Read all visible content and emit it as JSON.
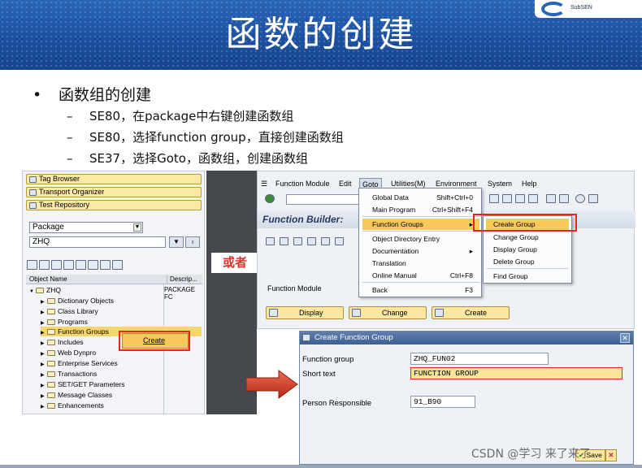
{
  "slide": {
    "title": "函数的创建",
    "bullet_main": "函数组的创建",
    "bullets_sub": [
      "SE80，在package中右键创建函数组",
      "SE80，选择function group，直接创建函数组",
      "SE37，选择Goto，函数组，创建函数组"
    ],
    "or_label": "或者",
    "watermark": "CSDN @学习  来了来了",
    "logo_text": "SubSEN",
    "bullet_dot": "•",
    "dash": "–"
  },
  "left_panel": {
    "yellow_buttons": [
      "Tag Browser",
      "Transport Organizer",
      "Test Repository"
    ],
    "object_type": "Package",
    "object_name": "ZHQ",
    "tree_header": {
      "col1": "Object Name",
      "col2": "Descrip..."
    },
    "root": {
      "label": "ZHQ",
      "description": "PACKAGE FC"
    },
    "tree_items": [
      "Dictionary Objects",
      "Class Library",
      "Programs",
      "Function Groups",
      "Includes",
      "Web Dynpro",
      "Enterprise Services",
      "Transactions",
      "SET/GET Parameters",
      "Message Classes",
      "Enhancements"
    ],
    "context_menu": "Create"
  },
  "sap_window": {
    "menu": [
      "Function Module",
      "Edit",
      "Goto",
      "Utilities(M)",
      "Environment",
      "System",
      "Help"
    ],
    "title": "Function Builder: ",
    "function_module_label": "Function Module",
    "buttons": [
      "Display",
      "Change",
      "Create"
    ],
    "goto_menu": [
      {
        "label": "Global Data",
        "shortcut": "Shift+Ctrl+0"
      },
      {
        "label": "Main Program",
        "shortcut": "Ctrl+Shift+F4"
      },
      {
        "label": "Function Groups",
        "shortcut": "▸"
      },
      {
        "label": "Object Directory Entry",
        "shortcut": ""
      },
      {
        "label": "Documentation",
        "shortcut": "▸"
      },
      {
        "label": "Translation",
        "shortcut": ""
      },
      {
        "label": "Online Manual",
        "shortcut": "Ctrl+F8"
      },
      {
        "label": "Back",
        "shortcut": "F3"
      }
    ],
    "function_groups_submenu": [
      "Create Group",
      "Change Group",
      "Display Group",
      "Delete Group",
      "Find Group"
    ]
  },
  "dialog": {
    "title": "Create Function Group",
    "fields": [
      {
        "label": "Function group",
        "value": "ZHQ_FUN02"
      },
      {
        "label": "Short text",
        "value": "FUNCTION GROUP"
      },
      {
        "label": "Person Responsible",
        "value": "91_B90"
      }
    ],
    "save_label": "Save",
    "close_glyph": "✕"
  },
  "colors": {
    "header_blue": "#1b4f9e",
    "sap_yellow": "#fbe7a2",
    "highlight_orange": "#f7c95c",
    "annotation_red": "#e2281f",
    "arrow_red": "#d8402c"
  }
}
